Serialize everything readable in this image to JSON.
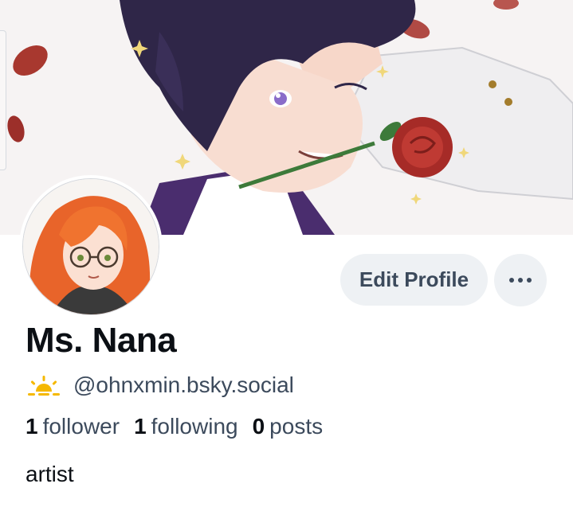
{
  "profile": {
    "display_name": "Ms. Nana",
    "handle": "@ohnxmin.bsky.social",
    "bio": "artist"
  },
  "stats": [
    {
      "count": "1",
      "label": "follower"
    },
    {
      "count": "1",
      "label": "following"
    },
    {
      "count": "0",
      "label": "posts"
    }
  ],
  "actions": {
    "edit_profile_label": "Edit Profile",
    "more_icon": "ellipsis-horizontal-icon"
  },
  "icons": {
    "handle_badge": "sunrise-icon"
  },
  "colors": {
    "button_bg": "#eef1f4",
    "secondary_text": "#3c4a5c",
    "primary_text": "#0b0f14",
    "badge_yellow": "#f5b800"
  }
}
